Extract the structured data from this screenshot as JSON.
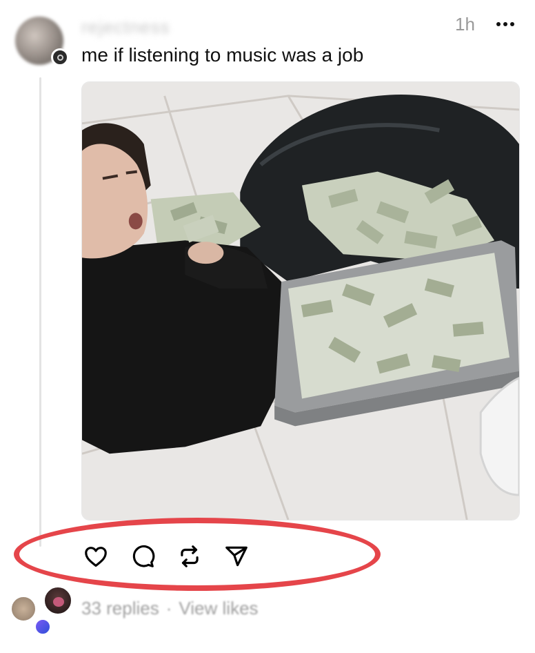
{
  "post": {
    "username": "rejectness",
    "timestamp": "1h",
    "caption": "me if listening to music was a job",
    "media": {
      "description_icon": "video-thumbnail"
    }
  },
  "actions": [
    {
      "name": "like",
      "icon": "heart-icon"
    },
    {
      "name": "reply",
      "icon": "comment-icon"
    },
    {
      "name": "repost",
      "icon": "repost-icon"
    },
    {
      "name": "share",
      "icon": "send-icon"
    }
  ],
  "footer": {
    "replies": "33 replies",
    "separator": "·",
    "view_likes": "View likes"
  },
  "colors": {
    "highlight": "#e5454a",
    "muted_text": "#9a9a9a"
  }
}
